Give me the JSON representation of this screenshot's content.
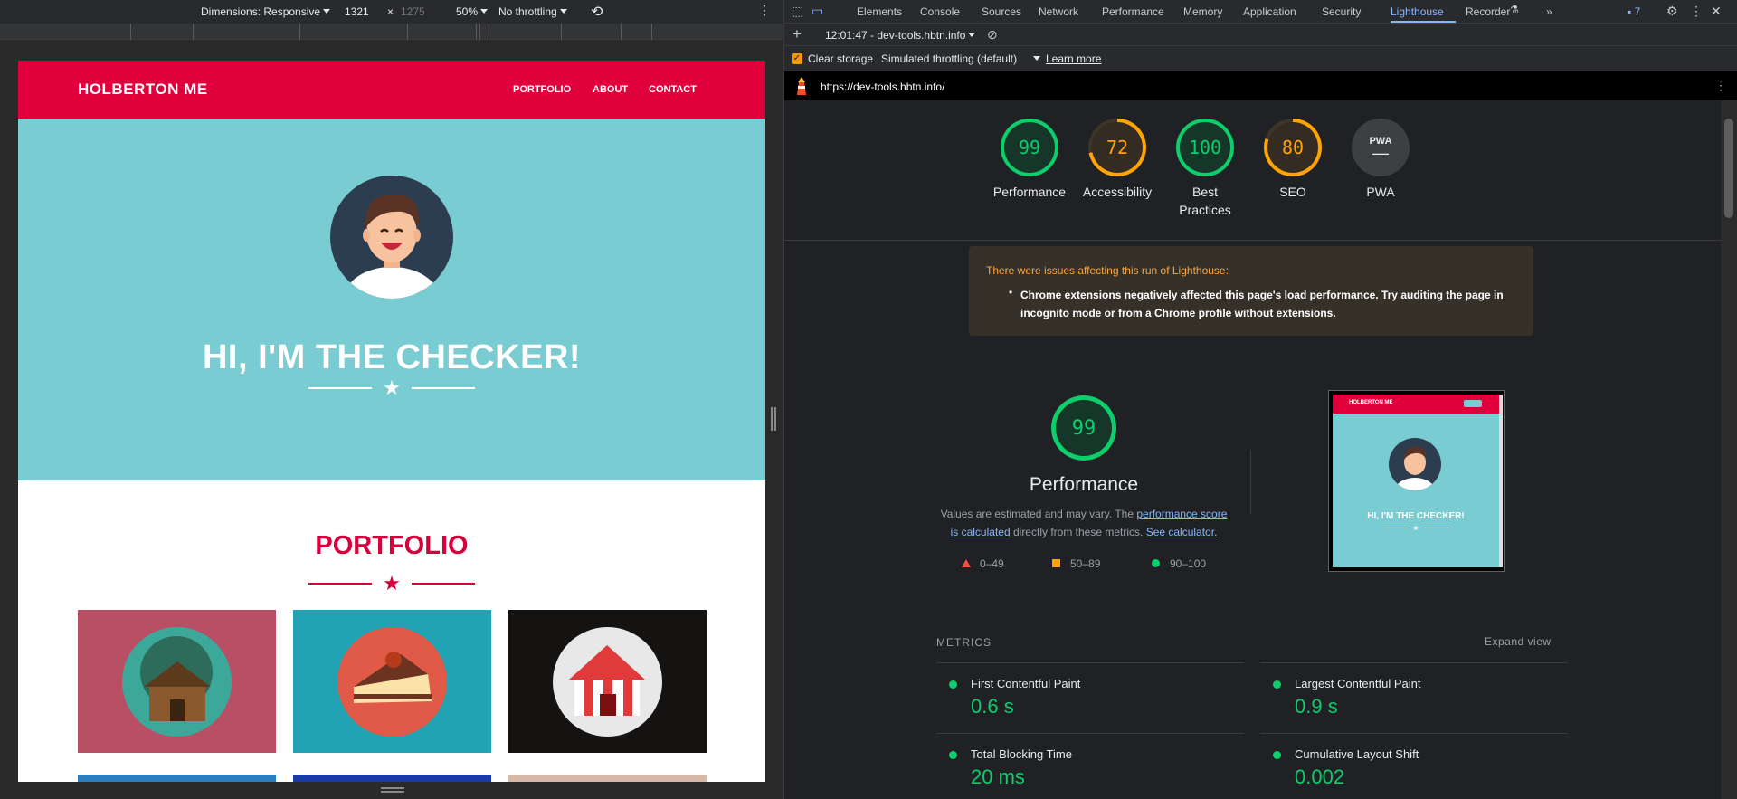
{
  "device_toolbar": {
    "dimensions_label": "Dimensions: Responsive",
    "width": "1321",
    "times": "×",
    "height": "1275",
    "zoom": "50%",
    "throttling": "No throttling"
  },
  "site": {
    "logo": "HOLBERTON ME",
    "nav": [
      "PORTFOLIO",
      "ABOUT",
      "CONTACT"
    ],
    "hero_title": "HI, I'M THE CHECKER!",
    "portfolio_title": "PORTFOLIO",
    "star": "★"
  },
  "devtools": {
    "tabs": [
      "Elements",
      "Console",
      "Sources",
      "Network",
      "Performance",
      "Memory",
      "Application",
      "Security",
      "Lighthouse",
      "Recorder"
    ],
    "active_tab": "Lighthouse",
    "more_tabs": "»",
    "issues_count": "7",
    "report_selector": "12:01:47 - dev-tools.hbtn.info",
    "clear_storage": "Clear storage",
    "throttling": "Simulated throttling (default)",
    "learn_more": "Learn more",
    "url": "https://dev-tools.hbtn.info/"
  },
  "gauges": [
    {
      "score": "99",
      "label": "Performance",
      "color": "#0cce6b"
    },
    {
      "score": "72",
      "label": "Accessibility",
      "color": "#ffa400"
    },
    {
      "score": "100",
      "label": "Best Practices",
      "color": "#0cce6b"
    },
    {
      "score": "80",
      "label": "SEO",
      "color": "#ffa400"
    },
    {
      "score": "—",
      "label": "PWA",
      "color": "#9aa0a6",
      "badge": "PWA"
    }
  ],
  "warning": {
    "title": "There were issues affecting this run of Lighthouse:",
    "item": "Chrome extensions negatively affected this page's load performance. Try auditing the page in incognito mode or from a Chrome profile without extensions."
  },
  "performance": {
    "score": "99",
    "title": "Performance",
    "desc_pre": "Values are estimated and may vary. The ",
    "link1": "performance score is calculated",
    "desc_mid": " directly from these metrics. ",
    "link2": "See calculator.",
    "legend": [
      {
        "range": "0–49",
        "color": "#ff4e42"
      },
      {
        "range": "50–89",
        "color": "#ffa400"
      },
      {
        "range": "90–100",
        "color": "#0cce6b"
      }
    ],
    "thumb_logo": "HOLBERTON ME",
    "thumb_title": "HI, I'M THE CHECKER!"
  },
  "metrics": {
    "header": "METRICS",
    "expand": "Expand view",
    "items": [
      {
        "name": "First Contentful Paint",
        "value": "0.6 s"
      },
      {
        "name": "Largest Contentful Paint",
        "value": "0.9 s"
      },
      {
        "name": "Total Blocking Time",
        "value": "20 ms"
      },
      {
        "name": "Cumulative Layout Shift",
        "value": "0.002"
      }
    ]
  }
}
